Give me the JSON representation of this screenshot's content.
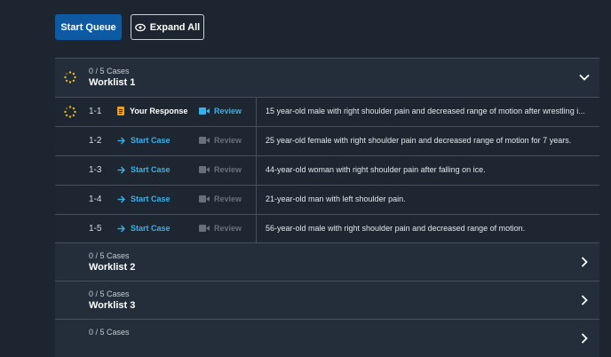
{
  "toolbar": {
    "start_queue_label": "Start Queue",
    "expand_all_label": "Expand All",
    "expand_all_icon": "eye-icon"
  },
  "worklists": [
    {
      "cases": "0 / 5 Cases",
      "title": "Worklist 1",
      "expanded": true,
      "rows": [
        {
          "num": "1-1",
          "action": "Your Response",
          "action_icon": "document-icon",
          "review": "Review",
          "review_active": true,
          "desc": "15 year-old male with right shoulder pain and decreased range of motion after wrestling i..."
        },
        {
          "num": "1-2",
          "action": "Start Case",
          "action_icon": "arrow-right-icon",
          "review": "Review",
          "review_active": false,
          "desc": "25 year-old female with right shoulder pain and decreased range of motion for 7 years."
        },
        {
          "num": "1-3",
          "action": "Start Case",
          "action_icon": "arrow-right-icon",
          "review": "Review",
          "review_active": false,
          "desc": "44-year-old woman with right shoulder pain after falling on ice."
        },
        {
          "num": "1-4",
          "action": "Start Case",
          "action_icon": "arrow-right-icon",
          "review": "Review",
          "review_active": false,
          "desc": "21-year-old man with left shoulder pain."
        },
        {
          "num": "1-5",
          "action": "Start Case",
          "action_icon": "arrow-right-icon",
          "review": "Review",
          "review_active": false,
          "desc": "56-year-old male with right shoulder pain and decreased range of motion."
        }
      ]
    },
    {
      "cases": "0 / 5 Cases",
      "title": "Worklist 2",
      "expanded": false
    },
    {
      "cases": "0 / 5 Cases",
      "title": "Worklist 3",
      "expanded": false
    },
    {
      "cases": "0 / 5 Cases",
      "title": "",
      "expanded": false
    }
  ],
  "colors": {
    "accent": "#3ab0e8",
    "primary_button": "#0d5aa2",
    "progress_icon": "#e8b923"
  }
}
